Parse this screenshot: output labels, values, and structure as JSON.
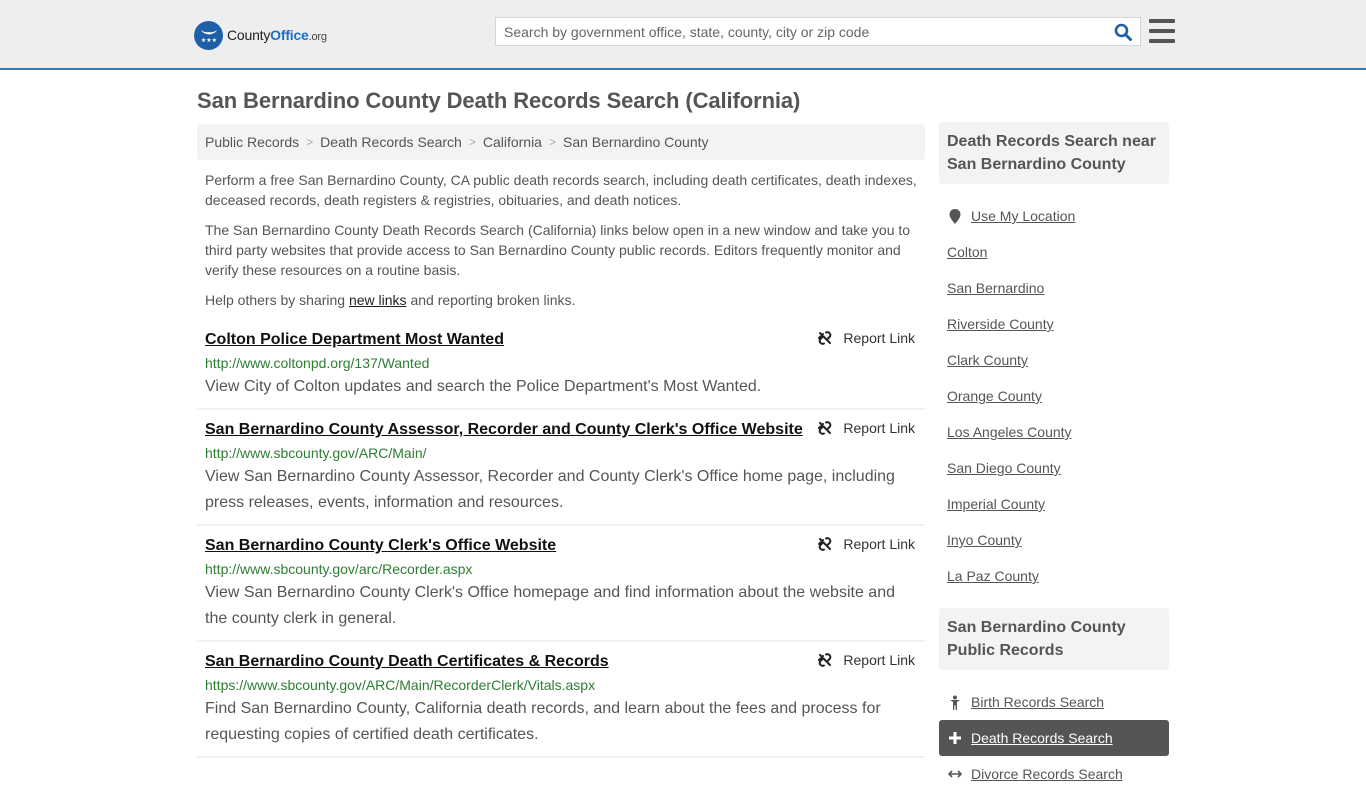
{
  "header": {
    "logo": {
      "county": "County",
      "office": "Office",
      "org": ".org"
    },
    "search_placeholder": "Search by government office, state, county, city or zip code",
    "colors": {
      "accent": "#3a78a8",
      "logo_blue": "#1d5fa8",
      "search_icon": "#1d5fa8"
    }
  },
  "page_title": "San Bernardino County Death Records Search (California)",
  "breadcrumb": [
    {
      "label": "Public Records"
    },
    {
      "label": "Death Records Search"
    },
    {
      "label": "California"
    },
    {
      "label": "San Bernardino County"
    }
  ],
  "intro": {
    "p1": "Perform a free San Bernardino County, CA public death records search, including death certificates, death indexes, deceased records, death registers & registries, obituaries, and death notices.",
    "p2": "The San Bernardino County Death Records Search (California) links below open in a new window and take you to third party websites that provide access to San Bernardino County public records. Editors frequently monitor and verify these resources on a routine basis.",
    "p3_before": "Help others by sharing ",
    "p3_link": "new links",
    "p3_after": " and reporting broken links."
  },
  "report_label": "Report Link",
  "results": [
    {
      "title": "Colton Police Department Most Wanted",
      "url": "http://www.coltonpd.org/137/Wanted",
      "desc": "View City of Colton updates and search the Police Department's Most Wanted."
    },
    {
      "title": "San Bernardino County Assessor, Recorder and County Clerk's Office Website",
      "url": "http://www.sbcounty.gov/ARC/Main/",
      "desc": "View San Bernardino County Assessor, Recorder and County Clerk's Office home page, including press releases, events, information and resources."
    },
    {
      "title": "San Bernardino County Clerk's Office Website",
      "url": "http://www.sbcounty.gov/arc/Recorder.aspx",
      "desc": "View San Bernardino County Clerk's Office homepage and find information about the website and the county clerk in general."
    },
    {
      "title": "San Bernardino County Death Certificates & Records",
      "url": "https://www.sbcounty.gov/ARC/Main/RecorderClerk/Vitals.aspx",
      "desc": "Find San Bernardino County, California death records, and learn about the fees and process for requesting copies of certified death certificates."
    }
  ],
  "sidebar": {
    "nearby_title": "Death Records Search near San Bernardino County",
    "use_location": "Use My Location",
    "nearby": [
      "Colton",
      "San Bernardino",
      "Riverside County",
      "Clark County",
      "Orange County",
      "Los Angeles County",
      "San Diego County",
      "Imperial County",
      "Inyo County",
      "La Paz County"
    ],
    "public_title": "San Bernardino County Public Records",
    "public_records": [
      {
        "label": "Birth Records Search",
        "icon": "person-icon",
        "active": false
      },
      {
        "label": "Death Records Search",
        "icon": "plus-icon",
        "active": true
      },
      {
        "label": "Divorce Records Search",
        "icon": "arrows-icon",
        "active": false
      }
    ]
  }
}
